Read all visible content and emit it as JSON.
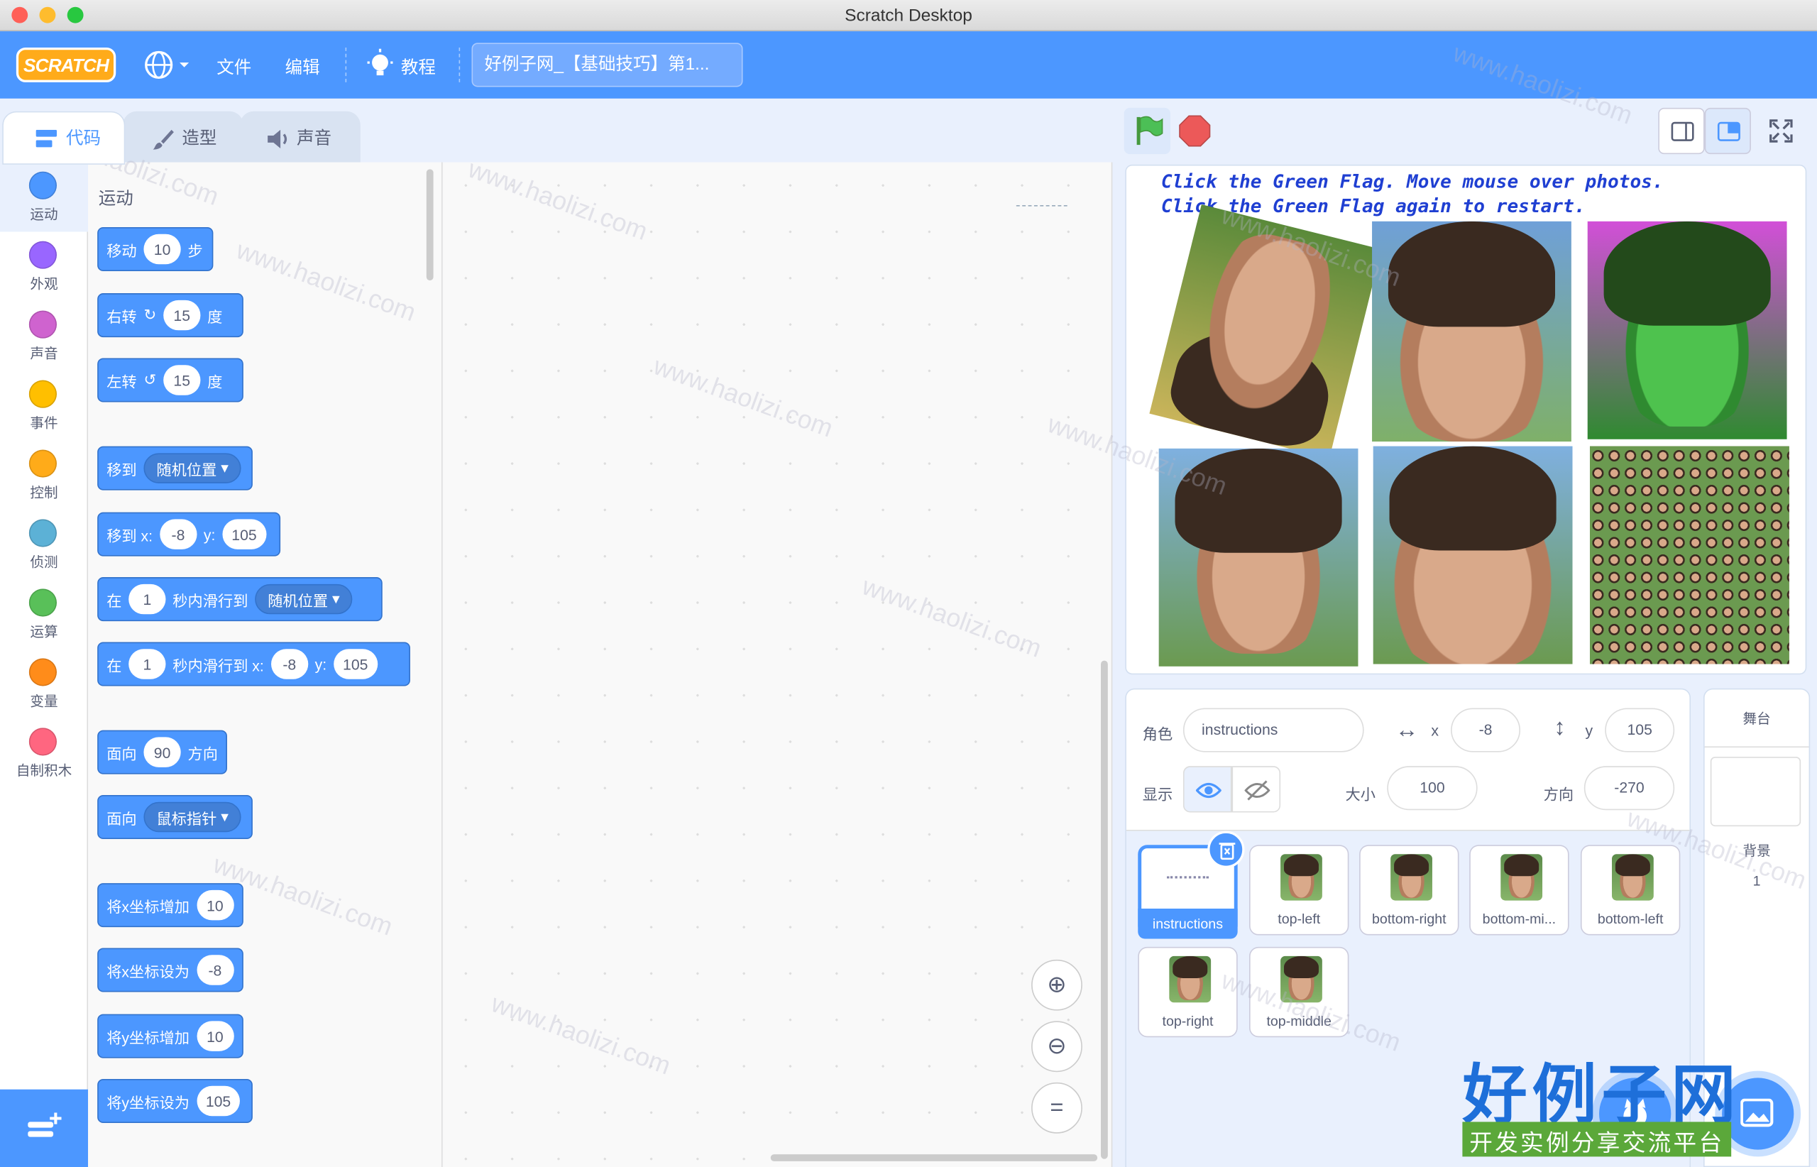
{
  "window": {
    "title": "Scratch Desktop"
  },
  "menubar": {
    "logo": "SCRATCH",
    "file": "文件",
    "edit": "编辑",
    "tutorials": "教程",
    "project_title": "好例子网_【基础技巧】第1..."
  },
  "tabs": {
    "code": "代码",
    "costumes": "造型",
    "sounds": "声音"
  },
  "categories": [
    {
      "label": "运动",
      "color": "#4c97ff"
    },
    {
      "label": "外观",
      "color": "#9966ff"
    },
    {
      "label": "声音",
      "color": "#cf63cf"
    },
    {
      "label": "事件",
      "color": "#ffbf00"
    },
    {
      "label": "控制",
      "color": "#ffab19"
    },
    {
      "label": "侦测",
      "color": "#5cb1d6"
    },
    {
      "label": "运算",
      "color": "#59c059"
    },
    {
      "label": "变量",
      "color": "#ff8c1a"
    },
    {
      "label": "自制积木",
      "color": "#ff6680"
    }
  ],
  "palette": {
    "heading": "运动",
    "move": {
      "a": "移动",
      "v": "10",
      "b": "步"
    },
    "turn_right": {
      "a": "右转",
      "v": "15",
      "b": "度"
    },
    "turn_left": {
      "a": "左转",
      "v": "15",
      "b": "度"
    },
    "goto": {
      "a": "移到",
      "dd": "随机位置"
    },
    "goto_xy": {
      "a": "移到 x:",
      "x": "-8",
      "b": "y:",
      "y": "105"
    },
    "glide": {
      "a": "在",
      "v": "1",
      "b": "秒内滑行到",
      "dd": "随机位置"
    },
    "glide_xy": {
      "a": "在",
      "v": "1",
      "b": "秒内滑行到 x:",
      "x": "-8",
      "c": "y:",
      "y": "105"
    },
    "point_dir": {
      "a": "面向",
      "v": "90",
      "b": "方向"
    },
    "point_towards": {
      "a": "面向",
      "dd": "鼠标指针"
    },
    "change_x": {
      "a": "将x坐标增加",
      "v": "10"
    },
    "set_x": {
      "a": "将x坐标设为",
      "v": "-8"
    },
    "change_y": {
      "a": "将y坐标增加",
      "v": "10"
    },
    "set_y": {
      "a": "将y坐标设为",
      "v": "105"
    }
  },
  "stage": {
    "line1": "Click the Green Flag. Move mouse over photos.",
    "line2": "Click the Green Flag again to restart."
  },
  "sprite_info": {
    "sprite_label": "角色",
    "sprite_name": "instructions",
    "x_label": "x",
    "x": "-8",
    "y_label": "y",
    "y": "105",
    "show_label": "显示",
    "size_label": "大小",
    "size": "100",
    "direction_label": "方向",
    "direction": "-270"
  },
  "sprites": [
    "instructions",
    "top-left",
    "bottom-right",
    "bottom-mi...",
    "bottom-left",
    "top-right",
    "top-middle"
  ],
  "stage_pane": {
    "title": "舞台",
    "backdrops_label": "背景",
    "backdrops_count": "1"
  },
  "watermark": {
    "text": "www.haolizi.com",
    "brand": "好例子网",
    "tagline": "开发实例分享交流平台"
  }
}
